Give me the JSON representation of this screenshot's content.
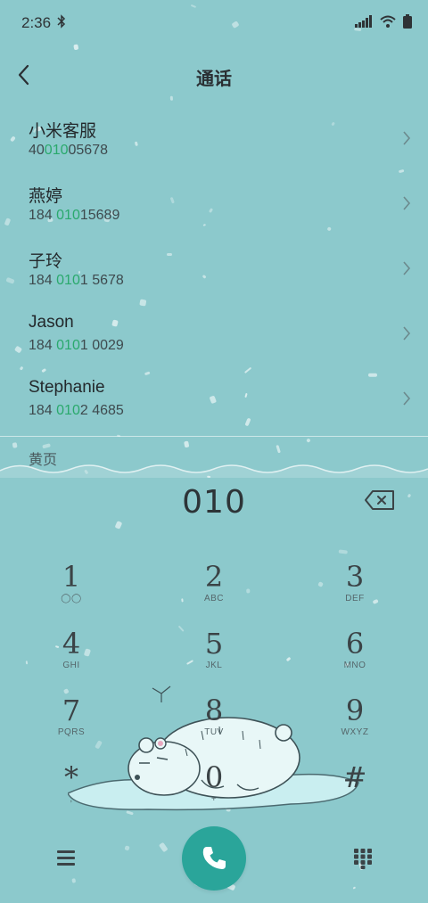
{
  "status_bar": {
    "time": "2:36"
  },
  "header": {
    "title": "通话"
  },
  "contacts": [
    {
      "name": "小米客服",
      "number_pre": "40",
      "number_hl": "010",
      "number_post": "05678"
    },
    {
      "name": "燕婷",
      "number_pre": "184 ",
      "number_hl": "010",
      "number_post": "15689"
    },
    {
      "name": "子玲",
      "number_pre": "184 ",
      "number_hl": "010",
      "number_post": "1 5678"
    },
    {
      "name": "Jason",
      "number_pre": "184 ",
      "number_hl": "010",
      "number_post": "1 0029"
    },
    {
      "name": "Stephanie",
      "number_pre": "184 ",
      "number_hl": "010",
      "number_post": "2 4685"
    }
  ],
  "yellow_pages_label": "黄页",
  "dial_input": "010",
  "keypad": [
    {
      "digit": "1",
      "letters": "◯◯"
    },
    {
      "digit": "2",
      "letters": "ABC"
    },
    {
      "digit": "3",
      "letters": "DEF"
    },
    {
      "digit": "4",
      "letters": "GHI"
    },
    {
      "digit": "5",
      "letters": "JKL"
    },
    {
      "digit": "6",
      "letters": "MNO"
    },
    {
      "digit": "7",
      "letters": "PQRS"
    },
    {
      "digit": "8",
      "letters": "TUV"
    },
    {
      "digit": "9",
      "letters": "WXYZ"
    },
    {
      "digit": "*",
      "letters": ","
    },
    {
      "digit": "0",
      "letters": "+"
    },
    {
      "digit": "#",
      "letters": ""
    }
  ],
  "colors": {
    "background": "#8cc9cc",
    "highlight": "#2aa96c",
    "call_button": "#2aa59a"
  },
  "icons": {
    "back": "chevron-left-icon",
    "row_arrow": "chevron-right-icon",
    "backspace": "backspace-icon",
    "menu": "menu-icon",
    "call": "phone-icon",
    "dialpad": "dialpad-icon"
  }
}
